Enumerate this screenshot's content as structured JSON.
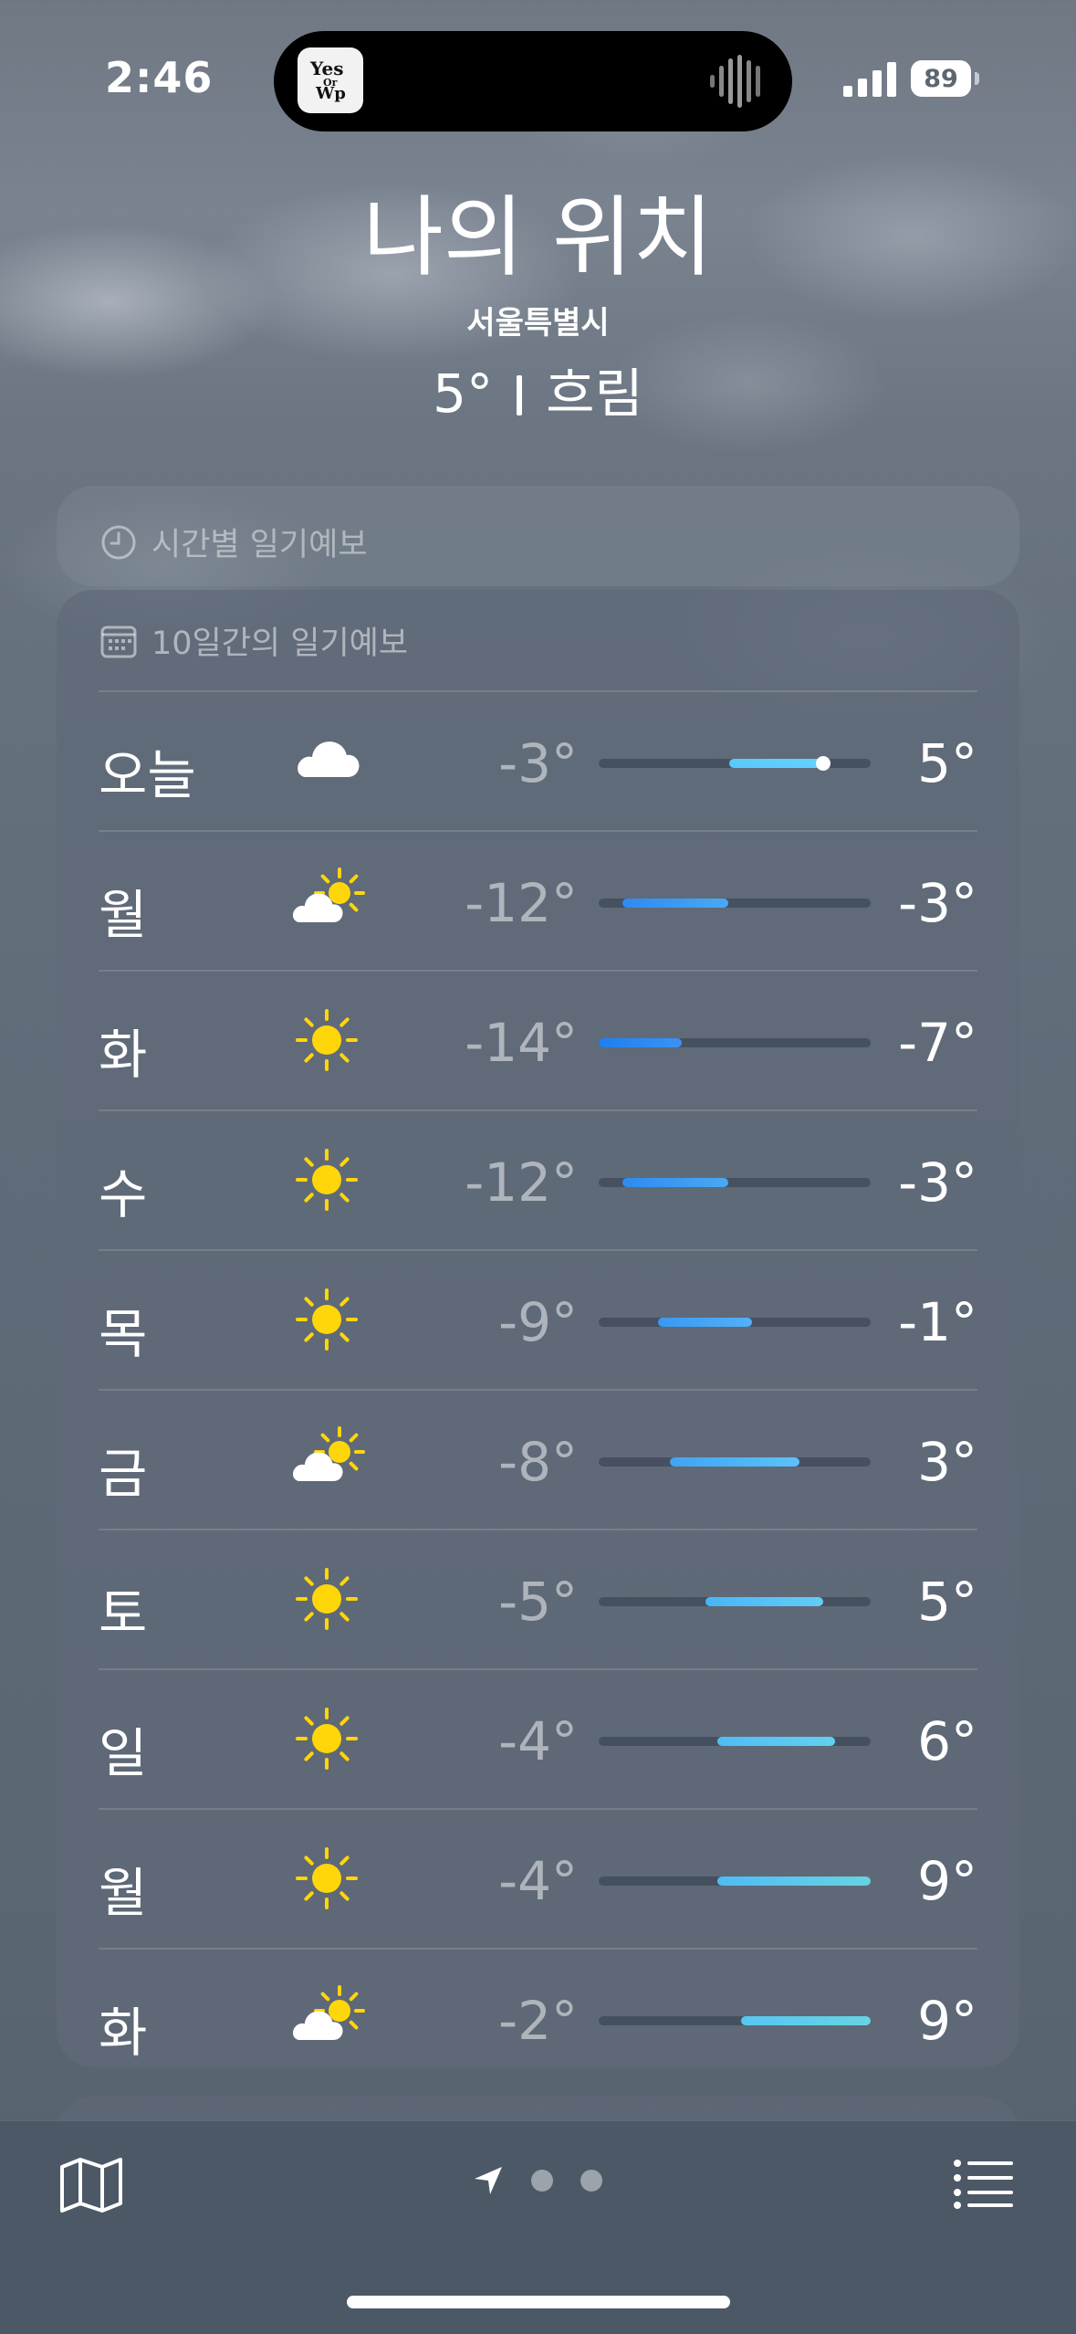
{
  "status_bar": {
    "time": "2:46",
    "battery": "89",
    "island_art_text": "Yes Or Wp"
  },
  "header": {
    "location": "나의 위치",
    "city": "서울특별시",
    "current_temp": "5°",
    "condition": "흐림"
  },
  "hourly_card": {
    "title": "시간별 일기예보",
    "icon": "clock-icon"
  },
  "daily_card": {
    "title": "10일간의 일기예보",
    "icon": "calendar-icon",
    "range_min": -14,
    "range_max": 9,
    "rows": [
      {
        "day": "오늘",
        "icon": "cloud",
        "low": "-3°",
        "high": "5°",
        "low_v": -3,
        "high_v": 5,
        "current_v": 5,
        "color_a": "#5ac8fa",
        "color_b": "#64d2ff"
      },
      {
        "day": "월",
        "icon": "partly-sunny",
        "low": "-12°",
        "high": "-3°",
        "low_v": -12,
        "high_v": -3,
        "color_a": "#2e8bf0",
        "color_b": "#4aa8f5"
      },
      {
        "day": "화",
        "icon": "sun",
        "low": "-14°",
        "high": "-7°",
        "low_v": -14,
        "high_v": -7,
        "color_a": "#1f7ff0",
        "color_b": "#3b93f2"
      },
      {
        "day": "수",
        "icon": "sun",
        "low": "-12°",
        "high": "-3°",
        "low_v": -12,
        "high_v": -3,
        "color_a": "#2e8bf0",
        "color_b": "#4aa8f5"
      },
      {
        "day": "목",
        "icon": "sun",
        "low": "-9°",
        "high": "-1°",
        "low_v": -9,
        "high_v": -1,
        "color_a": "#3a98f3",
        "color_b": "#52b1f6"
      },
      {
        "day": "금",
        "icon": "partly-sunny",
        "low": "-8°",
        "high": "3°",
        "low_v": -8,
        "high_v": 3,
        "color_a": "#41a3f4",
        "color_b": "#5cc2f8"
      },
      {
        "day": "토",
        "icon": "sun",
        "low": "-5°",
        "high": "5°",
        "low_v": -5,
        "high_v": 5,
        "color_a": "#4ab5f6",
        "color_b": "#62cdf6"
      },
      {
        "day": "일",
        "icon": "sun",
        "low": "-4°",
        "high": "6°",
        "low_v": -4,
        "high_v": 6,
        "color_a": "#4fbcf6",
        "color_b": "#63d0f0"
      },
      {
        "day": "월",
        "icon": "sun",
        "low": "-4°",
        "high": "9°",
        "low_v": -4,
        "high_v": 9,
        "color_a": "#4fbcf6",
        "color_b": "#66d4e2"
      },
      {
        "day": "화",
        "icon": "partly-sunny",
        "low": "-2°",
        "high": "9°",
        "low_v": -2,
        "high_v": 9,
        "color_a": "#58c6f2",
        "color_b": "#66d4e2"
      }
    ]
  },
  "bottom_bar": {
    "map": "map-icon",
    "location": "location-arrow-icon",
    "pages": 2,
    "list": "list-icon"
  },
  "colors": {
    "sun": "#ffd60a",
    "cloud": "#ffffff"
  }
}
